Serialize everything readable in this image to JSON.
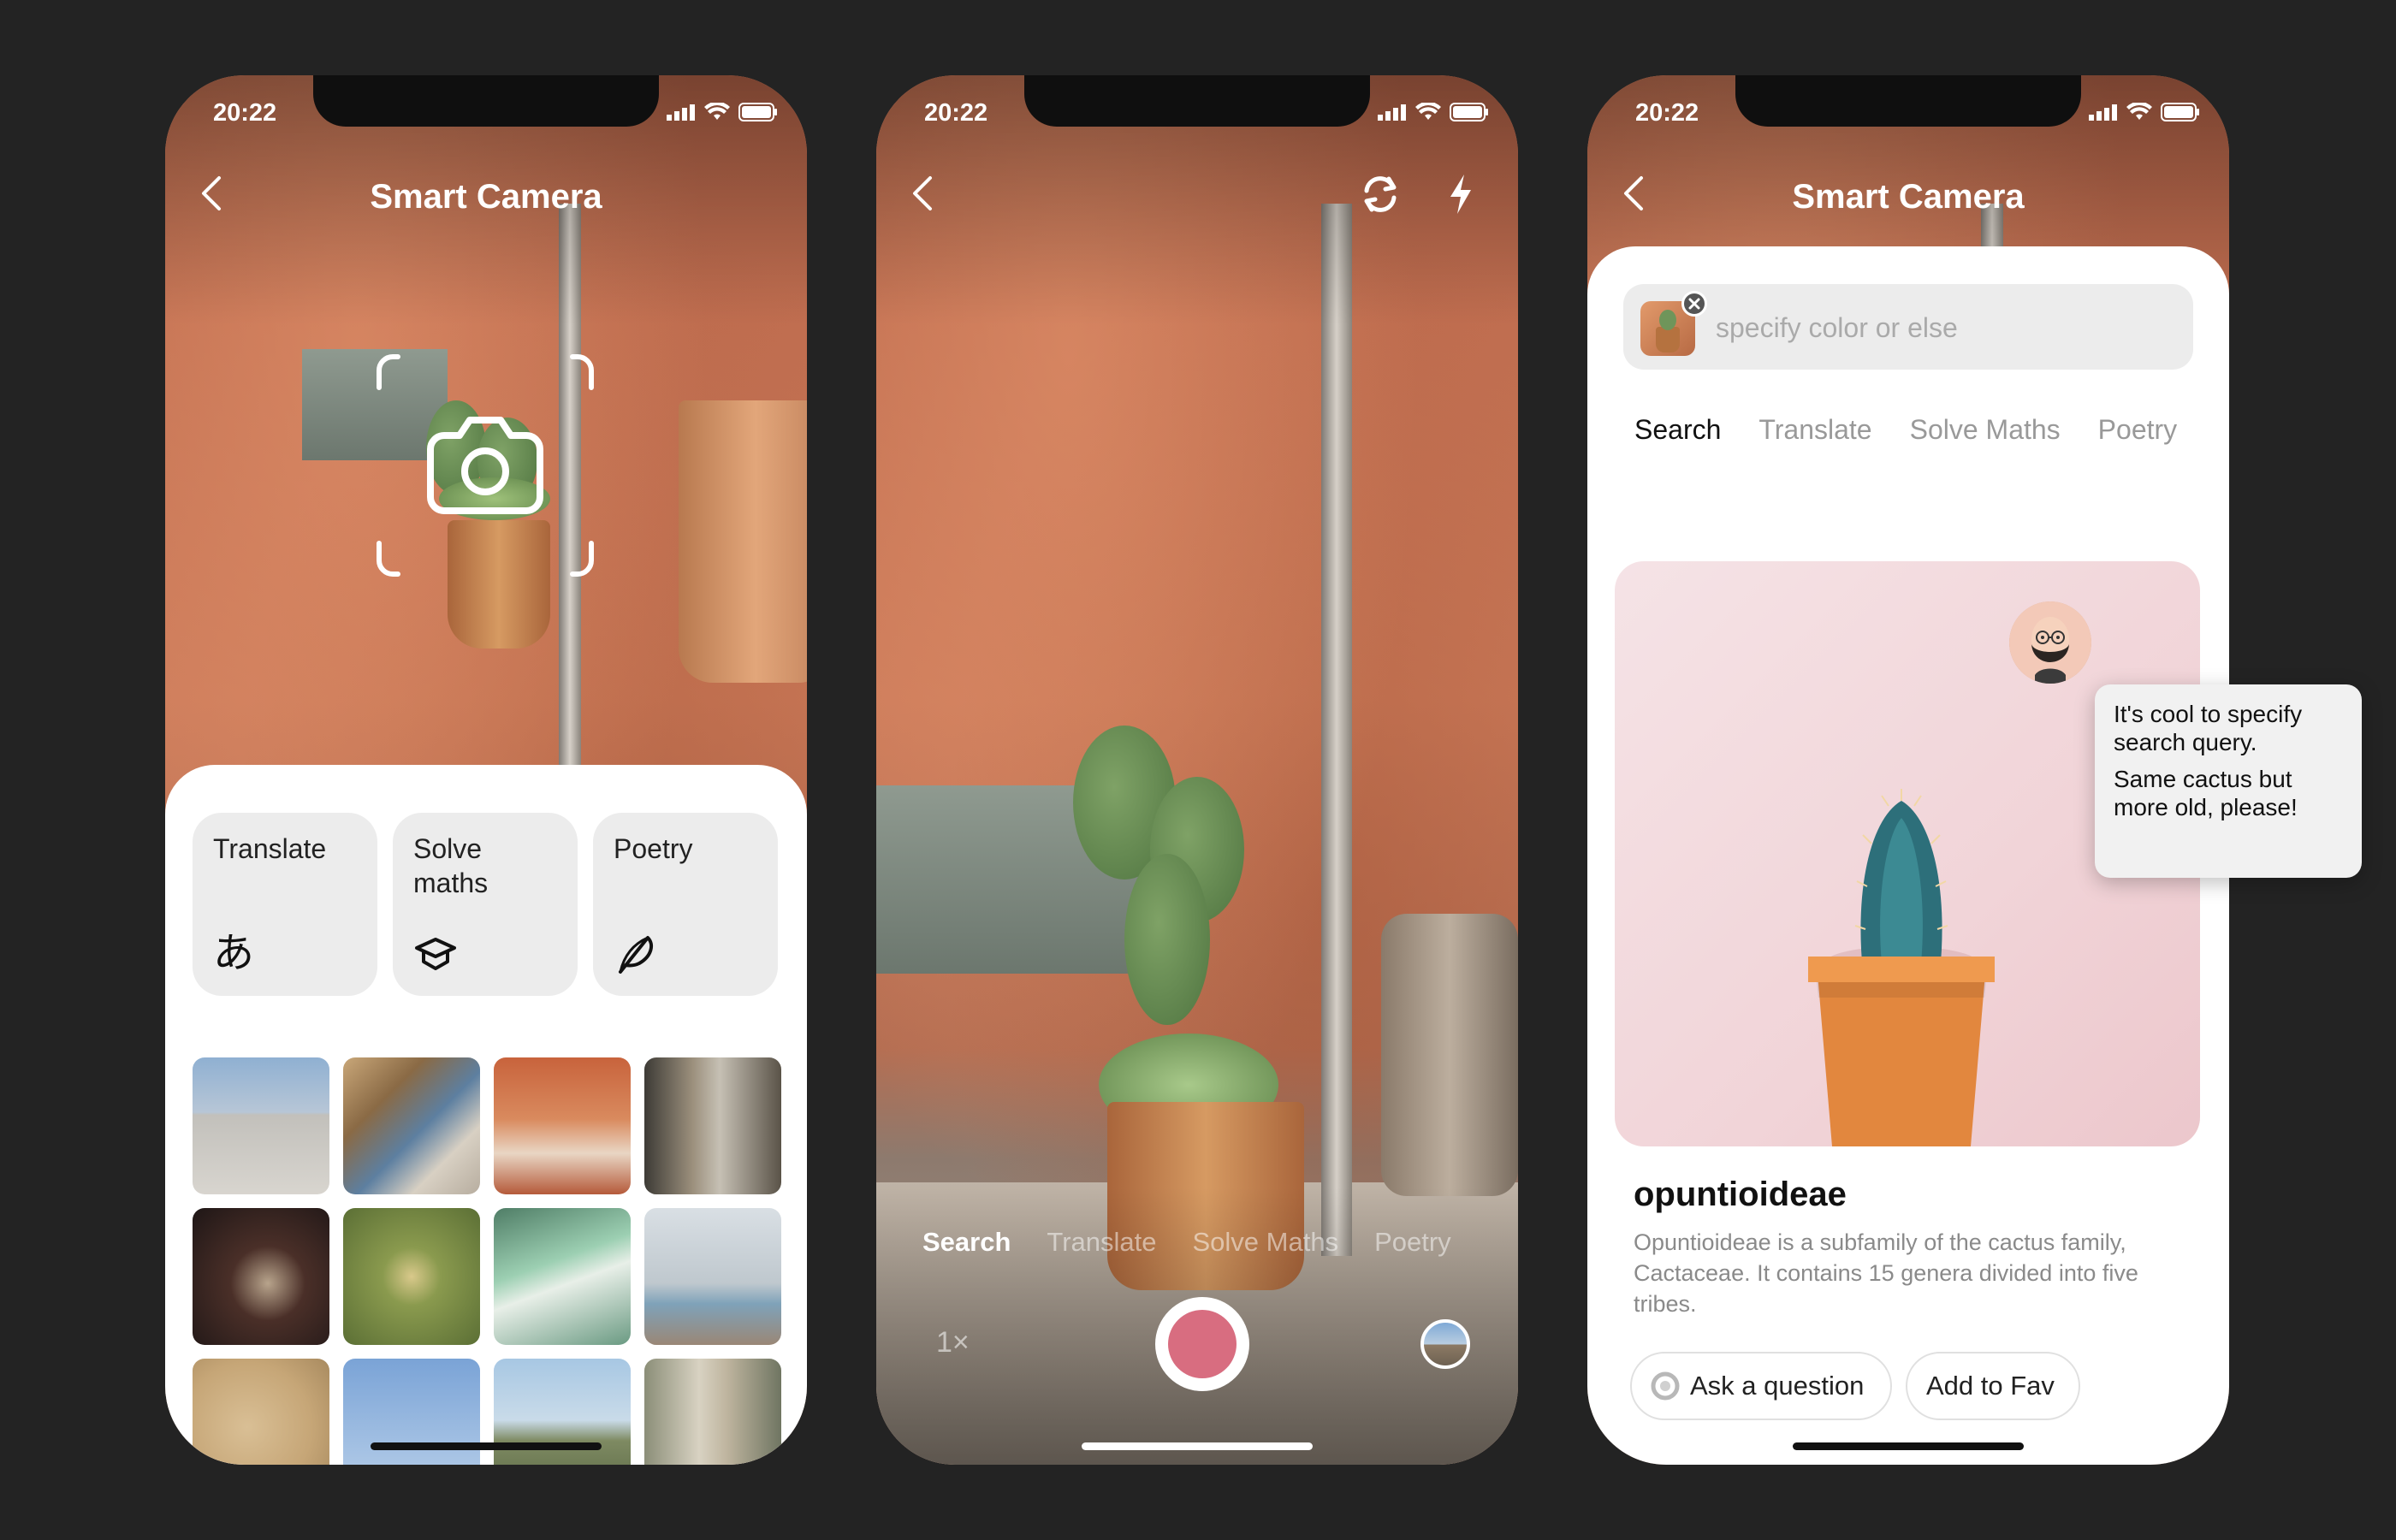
{
  "status": {
    "time": "20:22"
  },
  "phone1": {
    "title": "Smart Camera",
    "modes": [
      {
        "label": "Translate",
        "icon": "hiragana-icon"
      },
      {
        "label": "Solve maths",
        "icon": "graduation-cap-icon"
      },
      {
        "label": "Poetry",
        "icon": "feather-icon"
      }
    ],
    "gallery_count": 12
  },
  "phone2": {
    "modes": [
      "Search",
      "Translate",
      "Solve Maths",
      "Poetry"
    ],
    "active_mode": "Search",
    "zoom": "1×",
    "shutter_color": "#d86d80"
  },
  "phone3": {
    "title": "Smart Camera",
    "search": {
      "placeholder": "specify color or else",
      "value": ""
    },
    "tabs": [
      "Search",
      "Translate",
      "Solve Maths",
      "Poetry"
    ],
    "active_tab": "Search",
    "result": {
      "title": "opuntioideae",
      "description": "Opuntioideae is a subfamily of the cactus family, Cactaceae. It contains 15 genera divided into five tribes."
    },
    "actions": {
      "ask": "Ask a question",
      "fav": "Add to Fav"
    }
  },
  "tooltip": {
    "line1": "It's cool to specify search query.",
    "line2": "Same cactus but more old, please!"
  },
  "colors": {
    "background": "#232323",
    "sheet": "#ffffff",
    "accent": "#d86d80"
  }
}
